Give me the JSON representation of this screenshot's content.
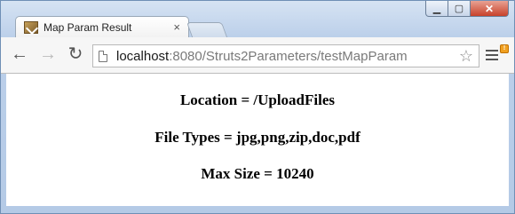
{
  "tab": {
    "title": "Map Param Result",
    "close_glyph": "×",
    "favicon": "page-favicon-icon"
  },
  "window_controls": {
    "minimize": "▁",
    "maximize": "▢",
    "close": "✕"
  },
  "toolbar": {
    "back": "←",
    "forward": "→",
    "reload": "↻",
    "star": "☆",
    "badge": "!"
  },
  "address": {
    "host": "localhost",
    "path": ":8080/Struts2Parameters/testMapParam"
  },
  "content": {
    "location": "Location = /UploadFiles",
    "file_types": "File Types = jpg,png,zip,doc,pdf",
    "max_size": "Max Size = 10240"
  },
  "colors": {
    "frame": "#bcd0ea",
    "close_button": "#c7412a",
    "badge": "#f0a020"
  }
}
